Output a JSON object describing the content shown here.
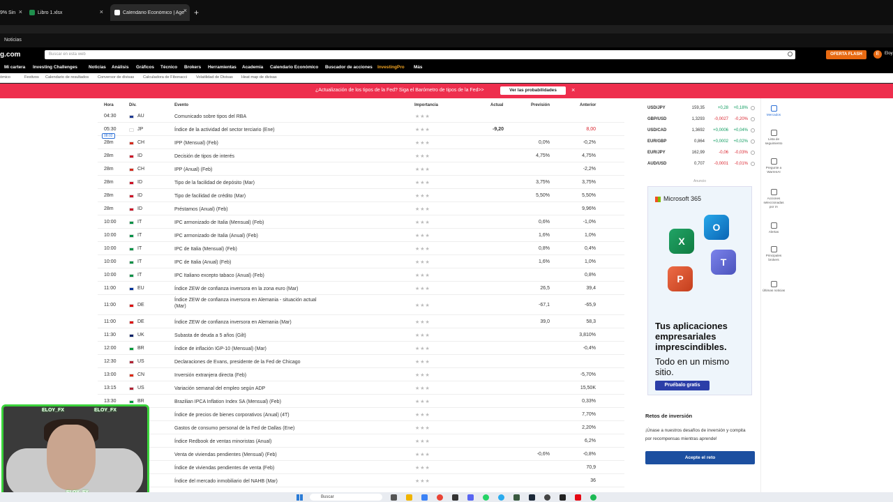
{
  "browser": {
    "tabs": [
      {
        "label": "9% Sin",
        "active": false
      },
      {
        "label": "Libro 1.xlsx",
        "active": false
      },
      {
        "label": "Calendario Económico | Agenda",
        "active": true
      }
    ],
    "bookmark": "Noticias"
  },
  "site": {
    "logo": "g.com",
    "search_placeholder": "Buscar en esta web",
    "oferta": "OFERTA FLASH",
    "user_initial": "E",
    "user_name": "Eloy"
  },
  "nav": [
    "Mi cartera",
    "Investing Challenges",
    "Noticias",
    "Análisis",
    "Gráficos",
    "Técnico",
    "Brokers",
    "Herramientas",
    "Academia",
    "Calendario Económico",
    "Buscador de acciones",
    "InvestingPro",
    "Más"
  ],
  "subnav": [
    "ómico",
    "Festivos",
    "Calendario de resultados",
    "Conversor de divisas",
    "Calculadora de Fibonacci",
    "Volatilidad de Divisas",
    "Heat map de divisas"
  ],
  "banner": {
    "text": "¿Actualización de los tipos de la Fed? Siga el Barómetro de tipos de la Fed>>",
    "button": "Ver las probabilidades",
    "close": "×"
  },
  "table": {
    "headers": {
      "hora": "Hora",
      "div": "Div.",
      "evento": "Evento",
      "importancia": "Importancia",
      "actual": "Actual",
      "prevision": "Previsión",
      "anterior": "Anterior"
    },
    "live_badge": "08:02",
    "rows": [
      {
        "hora": "04:30",
        "flag": "#1f3a93",
        "div": "AU",
        "evento": "Comunicado sobre tipos del RBA",
        "stars": "★★★",
        "actual": "",
        "prevision": "",
        "anterior": "",
        "ant_neg": false
      },
      {
        "hora": "05:30",
        "flag": "#ffffff",
        "div": "JP",
        "evento": "Índice de la actividad del sector terciario (Ene)",
        "stars": "★★★",
        "actual": "-9,20",
        "prevision": "",
        "anterior": "8,00",
        "ant_neg": true
      },
      {
        "hora": "28m",
        "flag": "#d52b1e",
        "div": "CH",
        "evento": "IPP (Mensual) (Feb)",
        "stars": "★★★",
        "actual": "",
        "prevision": "0,0%",
        "anterior": "-0,2%",
        "ant_neg": false
      },
      {
        "hora": "28m",
        "flag": "#ce1126",
        "div": "ID",
        "evento": "Decisión de tipos de interés",
        "stars": "★★★",
        "actual": "",
        "prevision": "4,75%",
        "anterior": "4,75%",
        "ant_neg": false
      },
      {
        "hora": "28m",
        "flag": "#d52b1e",
        "div": "CH",
        "evento": "IPP (Anual) (Feb)",
        "stars": "★★★",
        "actual": "",
        "prevision": "",
        "anterior": "-2,2%",
        "ant_neg": false
      },
      {
        "hora": "28m",
        "flag": "#ce1126",
        "div": "ID",
        "evento": "Tipo de la facilidad de depósito (Mar)",
        "stars": "★★★",
        "actual": "",
        "prevision": "3,75%",
        "anterior": "3,75%",
        "ant_neg": false
      },
      {
        "hora": "28m",
        "flag": "#ce1126",
        "div": "ID",
        "evento": "Tipo de facilidad de crédito (Mar)",
        "stars": "★★★",
        "actual": "",
        "prevision": "5,50%",
        "anterior": "5,50%",
        "ant_neg": false
      },
      {
        "hora": "28m",
        "flag": "#ce1126",
        "div": "ID",
        "evento": "Préstamos (Anual) (Feb)",
        "stars": "★★★",
        "actual": "",
        "prevision": "",
        "anterior": "9,96%",
        "ant_neg": false
      },
      {
        "hora": "10:00",
        "flag": "#009246",
        "div": "IT",
        "evento": "IPC armonizado de Italia (Mensual) (Feb)",
        "stars": "★★★",
        "actual": "",
        "prevision": "0,6%",
        "anterior": "-1,0%",
        "ant_neg": false
      },
      {
        "hora": "10:00",
        "flag": "#009246",
        "div": "IT",
        "evento": "IPC armonizado de Italia (Anual) (Feb)",
        "stars": "★★★",
        "actual": "",
        "prevision": "1,6%",
        "anterior": "1,0%",
        "ant_neg": false
      },
      {
        "hora": "10:00",
        "flag": "#009246",
        "div": "IT",
        "evento": "IPC de Italia (Mensual) (Feb)",
        "stars": "★★★",
        "actual": "",
        "prevision": "0,8%",
        "anterior": "0,4%",
        "ant_neg": false
      },
      {
        "hora": "10:00",
        "flag": "#009246",
        "div": "IT",
        "evento": "IPC de Italia (Anual) (Feb)",
        "stars": "★★★",
        "actual": "",
        "prevision": "1,6%",
        "anterior": "1,0%",
        "ant_neg": false
      },
      {
        "hora": "10:00",
        "flag": "#009246",
        "div": "IT",
        "evento": "IPC Italiano excepto tabaco (Anual) (Feb)",
        "stars": "★★★",
        "actual": "",
        "prevision": "",
        "anterior": "0,8%",
        "ant_neg": false
      },
      {
        "hora": "11:00",
        "flag": "#003399",
        "div": "EU",
        "evento": "Índice ZEW de confianza inversora en la zona euro (Mar)",
        "stars": "★★★",
        "actual": "",
        "prevision": "26,5",
        "anterior": "39,4",
        "ant_neg": false
      },
      {
        "hora": "11:00",
        "flag": "#dd0000",
        "div": "DE",
        "evento": "Índice ZEW de confianza inversora en Alemania - situación actual (Mar)",
        "stars": "★★★",
        "actual": "",
        "prevision": "-67,1",
        "anterior": "-65,9",
        "ant_neg": false
      },
      {
        "hora": "11:00",
        "flag": "#dd0000",
        "div": "DE",
        "evento": "Índice ZEW de confianza inversora en Alemania (Mar)",
        "stars": "★★★",
        "actual": "",
        "prevision": "39,0",
        "anterior": "58,3",
        "ant_neg": false
      },
      {
        "hora": "11:30",
        "flag": "#012169",
        "div": "UK",
        "evento": "Subasta de deuda a 5 años (Gilt)",
        "stars": "★★★",
        "actual": "",
        "prevision": "",
        "anterior": "3,810%",
        "ant_neg": false
      },
      {
        "hora": "12:00",
        "flag": "#009c3b",
        "div": "BR",
        "evento": "Índice de inflación IGP-10 (Mensual) (Mar)",
        "stars": "★★★",
        "actual": "",
        "prevision": "",
        "anterior": "-0,4%",
        "ant_neg": false
      },
      {
        "hora": "12:30",
        "flag": "#b22234",
        "div": "US",
        "evento": "Declaraciones de Evans, presidente de la Fed de Chicago",
        "stars": "★★★",
        "actual": "",
        "prevision": "",
        "anterior": "",
        "ant_neg": false
      },
      {
        "hora": "13:00",
        "flag": "#de2910",
        "div": "CN",
        "evento": "Inversión extranjera directa (Feb)",
        "stars": "★★★",
        "actual": "",
        "prevision": "",
        "anterior": "-5,70%",
        "ant_neg": false
      },
      {
        "hora": "13:15",
        "flag": "#b22234",
        "div": "US",
        "evento": "Variación semanal del empleo según ADP",
        "stars": "★★★",
        "actual": "",
        "prevision": "",
        "anterior": "15,50K",
        "ant_neg": false
      },
      {
        "hora": "13:30",
        "flag": "#009c3b",
        "div": "BR",
        "evento": "Brazilian IPCA Inflation Index SA (Mensual) (Feb)",
        "stars": "★★★",
        "actual": "",
        "prevision": "",
        "anterior": "0,33%",
        "ant_neg": false
      },
      {
        "hora": "",
        "flag": "#b22234",
        "div": "",
        "evento": "Índice de precios de bienes corporativos (Anual) (4T)",
        "stars": "★★★",
        "actual": "",
        "prevision": "",
        "anterior": "7,70%",
        "ant_neg": false
      },
      {
        "hora": "",
        "flag": "#b22234",
        "div": "",
        "evento": "Gastos de consumo personal de la Fed de Dallas (Ene)",
        "stars": "★★★",
        "actual": "",
        "prevision": "",
        "anterior": "2,20%",
        "ant_neg": false
      },
      {
        "hora": "",
        "flag": "#b22234",
        "div": "",
        "evento": "Índice Redbook de ventas minoristas (Anual)",
        "stars": "★★★",
        "actual": "",
        "prevision": "",
        "anterior": "6,2%",
        "ant_neg": false
      },
      {
        "hora": "",
        "flag": "#b22234",
        "div": "",
        "evento": "Venta de viviendas pendientes (Mensual) (Feb)",
        "stars": "★★★",
        "actual": "",
        "prevision": "-0,6%",
        "anterior": "-0,8%",
        "ant_neg": false
      },
      {
        "hora": "",
        "flag": "#b22234",
        "div": "",
        "evento": "Índice de viviendas pendientes de venta (Feb)",
        "stars": "★★★",
        "actual": "",
        "prevision": "",
        "anterior": "70,9",
        "ant_neg": false
      },
      {
        "hora": "",
        "flag": "#b22234",
        "div": "",
        "evento": "Índice del mercado inmobiliario del NAHB (Mar)",
        "stars": "★★★",
        "actual": "",
        "prevision": "",
        "anterior": "36",
        "ant_neg": false
      }
    ]
  },
  "fx": [
    {
      "pair": "USD/JPY",
      "price": "159,35",
      "chg": "+0,28",
      "pct": "+0,18%",
      "up": true
    },
    {
      "pair": "GBP/USD",
      "price": "1,3293",
      "chg": "-0,0027",
      "pct": "-0,20%",
      "up": false
    },
    {
      "pair": "USD/CAD",
      "price": "1,3692",
      "chg": "+0,0006",
      "pct": "+0,04%",
      "up": true
    },
    {
      "pair": "EUR/GBP",
      "price": "0,864",
      "chg": "+0,0002",
      "pct": "+0,02%",
      "up": true
    },
    {
      "pair": "EUR/JPY",
      "price": "162,99",
      "chg": "-0,06",
      "pct": "-0,03%",
      "up": false
    },
    {
      "pair": "AUD/USD",
      "price": "0,707",
      "chg": "-0,0001",
      "pct": "-0,01%",
      "up": false
    }
  ],
  "ad": {
    "label": "Anuncio",
    "brand": "Microsoft 365",
    "headline": "Tus aplicaciones empresariales imprescindibles.",
    "sub": "Todo en un mismo sitio.",
    "button": "Pruébalo gratis"
  },
  "retos": {
    "title": "Retos de inversión",
    "text": "¡Únase a nuestros desafíos de inversión y compita por recompensas mientras aprende!",
    "button": "Acepte el reto"
  },
  "rail": [
    "Mercados",
    "Lista de seguimiento",
    "Pregunte a WarrenAI",
    "Acciones seleccionadas por IA",
    "Alertas",
    "Principales brokers",
    "Últimas noticias"
  ],
  "webcam": {
    "label1": "ELOY_FX",
    "label2": "ELOY_FX",
    "label3": "ELOY_FX"
  },
  "taskbar": {
    "search": "Buscar"
  }
}
